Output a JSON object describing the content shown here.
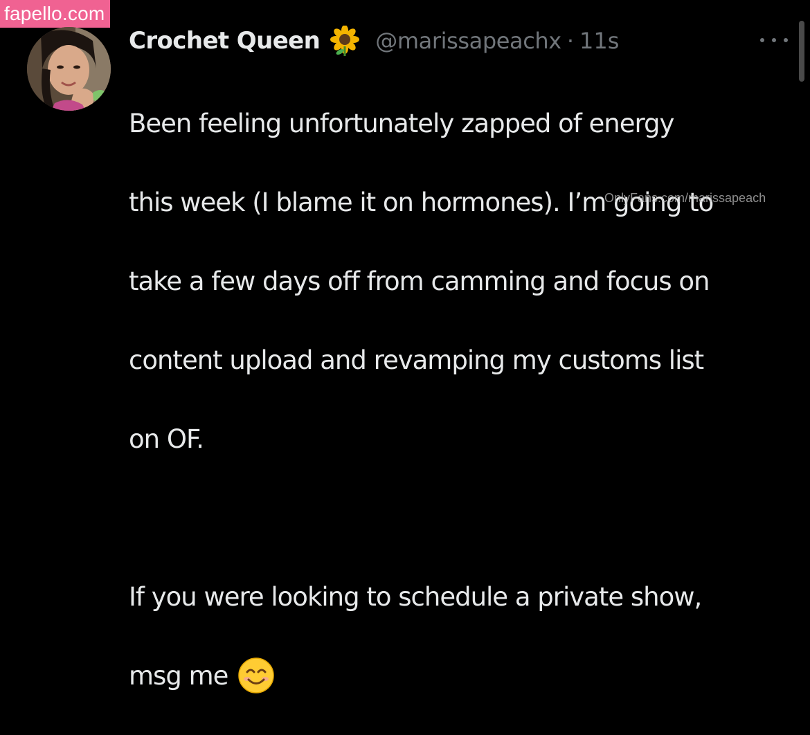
{
  "site_watermark": "fapello.com",
  "tweet": {
    "display_name": "Crochet Queen",
    "name_emoji": "sunflower-icon",
    "handle": "@marissapeachx",
    "separator": "·",
    "time": "11s",
    "body_lines": [
      "Been feeling unfortunately zapped of energy",
      "this week (I blame it on hormones). I’m going to",
      "take a few days off from camming and focus on",
      "content upload and revamping my customs list",
      "on OF.",
      "If you were looking to schedule a private show,",
      "msg me"
    ],
    "end_emoji": "smiling-face-icon"
  },
  "overlay_watermark": "OnlyFans.com/marissapeach",
  "colors": {
    "background": "#000000",
    "primary_text": "#e7e9ea",
    "secondary_text": "#71767b",
    "watermark_bg": "#f06292"
  }
}
